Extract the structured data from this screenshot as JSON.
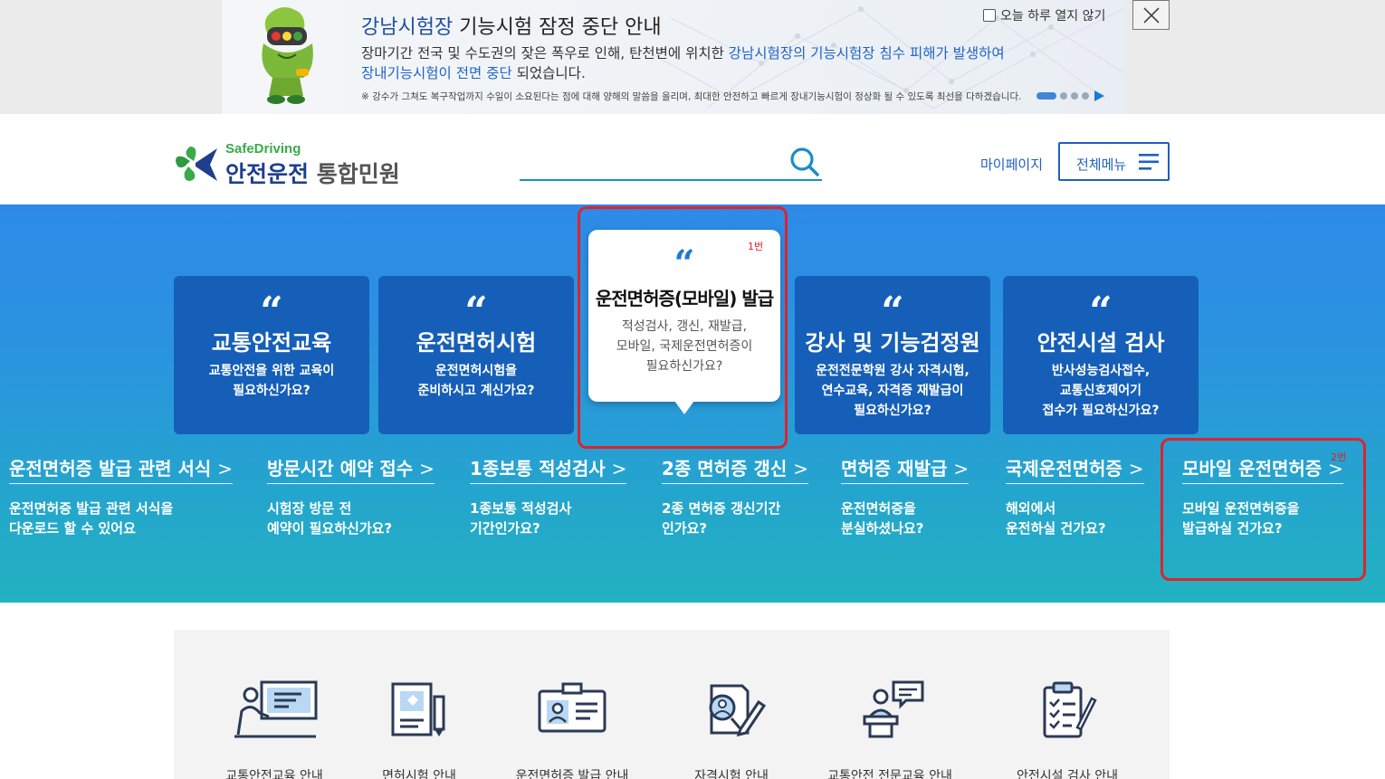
{
  "notice": {
    "title_highlight": "강남시험장",
    "title_rest": " 기능시험 잠정 중단 안내",
    "body_line1_plain": "장마기간 전국 및 수도권의 잦은 폭우로 인해, 탄천변에 위치한 ",
    "body_line1_highlight": "강남시험장의 기능시험장 침수 피해가 발생하여",
    "body_line2_highlight": "장내기능시험이 전면 중단",
    "body_line2_plain": " 되었습니다.",
    "small_text": "※ 강수가 그쳐도 복구작업까지 수일이 소요된다는 점에 대해 양해의 말씀을 올리며, 최대한 안전하고 빠르게 장내기능시험이 정상화 될 수 있도록 최선을 다하겠습니다.",
    "dont_show_label": "오늘 하루 열지 않기",
    "close_label": "닫기"
  },
  "header": {
    "logo_sub": "SafeDriving",
    "logo_main": "안전운전",
    "logo_main_gray": " 통합민원",
    "search_placeholder": "",
    "mypage_label": "마이페이지",
    "menu_label": "전체메뉴"
  },
  "hero": {
    "quote": "“",
    "cards": [
      {
        "title": "교통안전교육",
        "desc_line1": "교통안전을 위한 교육이",
        "desc_line2": "필요하신가요?",
        "desc_line3": ""
      },
      {
        "title": "운전면허시험",
        "desc_line1": "운전면허시험을",
        "desc_line2": "준비하시고 계신가요?",
        "desc_line3": ""
      },
      {
        "title": "강사 및 기능검정원",
        "desc_line1": "운전전문학원 강사 자격시험,",
        "desc_line2": "연수교육, 자격증 재발급이",
        "desc_line3": "필요하신가요?"
      },
      {
        "title": "안전시설 검사",
        "desc_line1": "반사성능검사접수,",
        "desc_line2": "교통신호제어기",
        "desc_line3": "접수가 필요하신가요?"
      }
    ],
    "featured": {
      "title": "운전면허증(모바일) 발급",
      "desc_line1": "적성검사, 갱신, 재발급,",
      "desc_line2": "모바일, 국제운전면허증이",
      "desc_line3": "필요하신가요?"
    },
    "annotation_1": "1번",
    "annotation_2": "2번",
    "links": [
      {
        "title": "운전면허증 발급 관련 서식",
        "desc_line1": "운전면허증 발급 관련 서식을",
        "desc_line2": "다운로드 할 수 있어요"
      },
      {
        "title": "방문시간 예약 접수",
        "desc_line1": "시험장 방문 전",
        "desc_line2": "예약이 필요하신가요?"
      },
      {
        "title": "1종보통 적성검사",
        "desc_line1": "1종보통 적성검사",
        "desc_line2": "기간인가요?"
      },
      {
        "title": "2종 면허증 갱신",
        "desc_line1": "2종 면허증 갱신기간",
        "desc_line2": "인가요?"
      },
      {
        "title": "면허증 재발급",
        "desc_line1": "운전면허증을",
        "desc_line2": "분실하셨나요?"
      },
      {
        "title": "국제운전면허증",
        "desc_line1": "해외에서",
        "desc_line2": "운전하실 건가요?"
      },
      {
        "title": "모바일 운전면허증",
        "desc_line1": "모바일 운전면허증을",
        "desc_line2": "발급하실 건가요?"
      }
    ],
    "link_arrow": ">"
  },
  "services": [
    {
      "label": "교통안전교육 안내",
      "icon": "teacher-board-icon"
    },
    {
      "label": "면허시험 안내",
      "icon": "document-pen-icon"
    },
    {
      "label": "운전면허증 발급 안내",
      "icon": "id-card-icon"
    },
    {
      "label": "자격시험 안내",
      "icon": "person-paper-pen-icon"
    },
    {
      "label": "교통안전 전문교육 안내",
      "icon": "speaker-podium-icon"
    },
    {
      "label": "안전시설 검사 안내",
      "icon": "clipboard-checklist-icon"
    }
  ],
  "colors": {
    "brand_blue": "#1f5fc4",
    "card_blue": "#155fb8",
    "annotation_red": "#e0232b",
    "logo_green": "#3aaa49"
  }
}
